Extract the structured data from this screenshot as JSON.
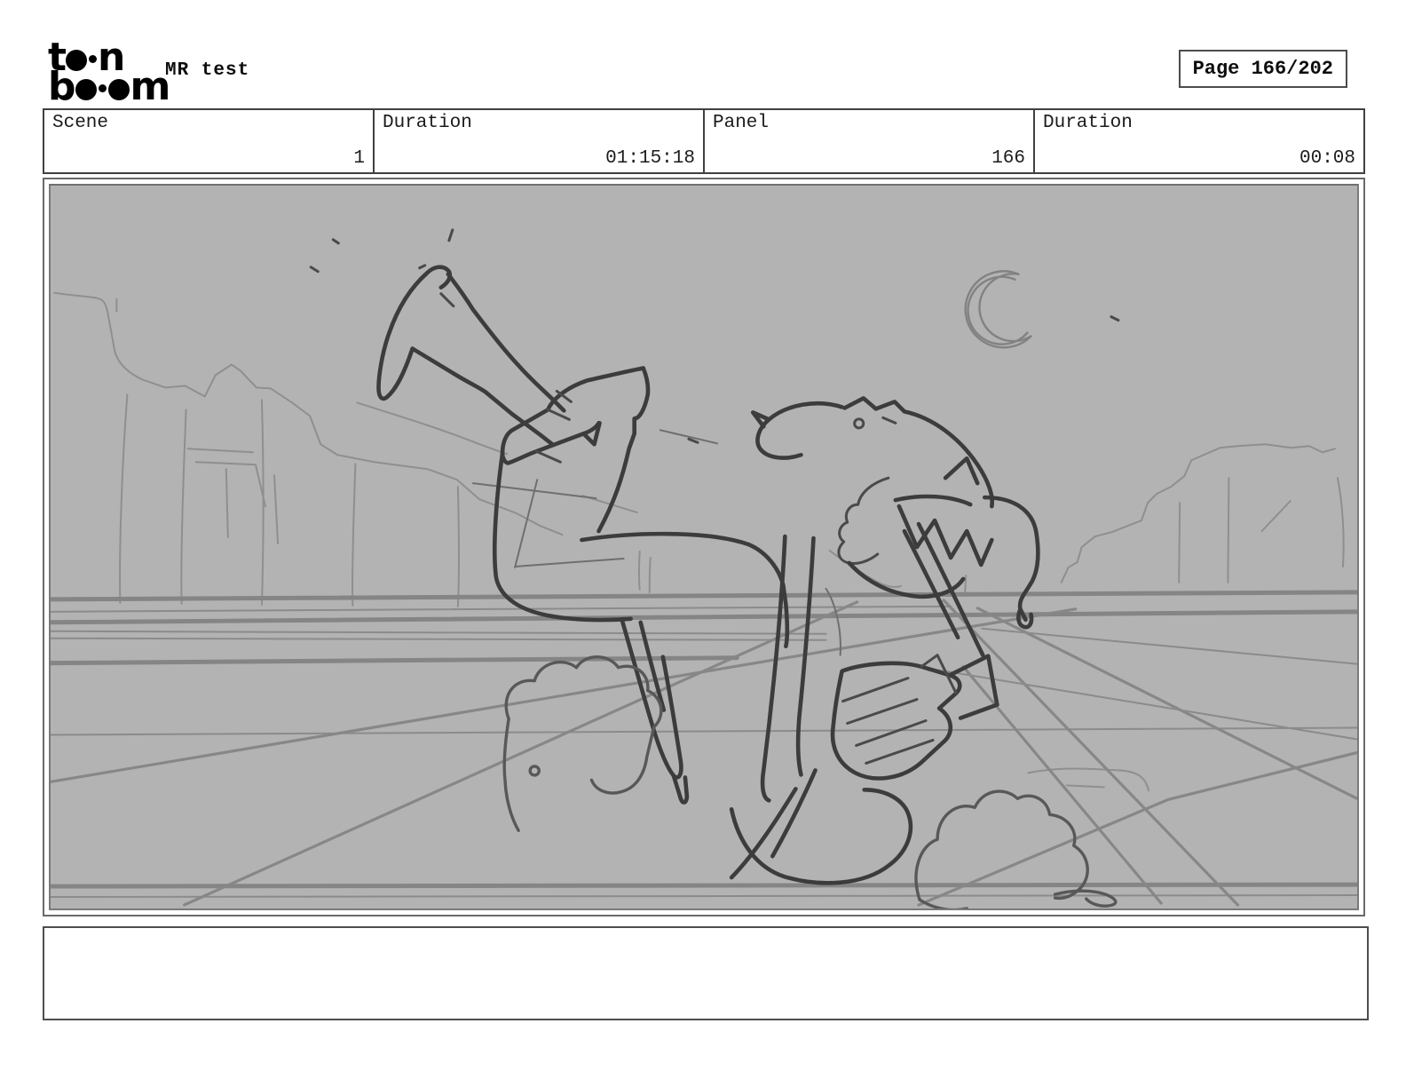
{
  "header": {
    "logo": {
      "t": "t",
      "n": "n",
      "b": "b",
      "m": "m"
    },
    "title": "MR test",
    "page_indicator": "Page 166/202"
  },
  "info_table": {
    "cells": [
      {
        "label": "Scene",
        "value": "1"
      },
      {
        "label": "Duration",
        "value": "01:15:18"
      },
      {
        "label": "Panel",
        "value": "166"
      },
      {
        "label": "Duration",
        "value": "00:08"
      }
    ]
  },
  "storyboard_panel": {
    "description": "Rough pencil sketch: cartoon character crashed upside-down on a perspective grid floor, big sneakers in the air, dust clouds, desert cliffs and a crescent moon in the background",
    "canvas_color": "#b3b3b3",
    "sketch_line_color": "#3c3c3c",
    "background_line_color": "#8f8f8f",
    "grid_line_color": "#878787"
  },
  "caption_box": {
    "text": ""
  }
}
